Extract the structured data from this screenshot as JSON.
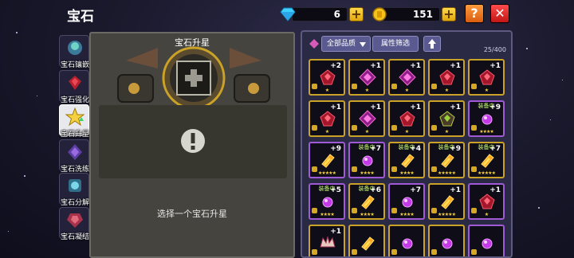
{
  "header": {
    "title": "宝石"
  },
  "currency": {
    "diamonds": "6",
    "coins": "151",
    "add_label": "+"
  },
  "buttons": {
    "help_label": "?",
    "close_label": "✕"
  },
  "tabs": [
    {
      "label": "宝石镶嵌",
      "icon": "gem-socket-icon",
      "active": false
    },
    {
      "label": "宝石强化",
      "icon": "gem-strengthen-icon",
      "active": false
    },
    {
      "label": "宝石升星",
      "icon": "star-up-icon",
      "active": true
    },
    {
      "label": "宝石洗练",
      "icon": "gem-refine-icon",
      "active": false
    },
    {
      "label": "宝石分解",
      "icon": "gem-decompose-icon",
      "active": false
    },
    {
      "label": "宝石凝结",
      "icon": "gem-condense-icon",
      "active": false
    }
  ],
  "upgrade_panel": {
    "title": "宝石升星",
    "hint": "选择一个宝石升星",
    "empty_icon": "exclamation-icon",
    "slot_icon": "plus-icon"
  },
  "inventory": {
    "filter_quality": "全部品质",
    "filter_attribute": "属性筛选",
    "sort_icon": "arrow-up-icon",
    "count": "25/400",
    "equipped_label": "装备中",
    "rows": [
      [
        {
          "lvl": "+2",
          "gem": "red-gem",
          "stars": "★",
          "equipped": false,
          "border": "gold"
        },
        {
          "lvl": "+1",
          "gem": "magenta-gem",
          "stars": "★",
          "equipped": false,
          "border": "gold"
        },
        {
          "lvl": "+1",
          "gem": "magenta-gem",
          "stars": "★",
          "equipped": false,
          "border": "gold"
        },
        {
          "lvl": "+1",
          "gem": "red-gem",
          "stars": "★",
          "equipped": false,
          "border": "gold"
        },
        {
          "lvl": "+1",
          "gem": "red-gem",
          "stars": "★",
          "equipped": false,
          "border": "gold"
        }
      ],
      [
        {
          "lvl": "+1",
          "gem": "red-gem",
          "stars": "★",
          "equipped": false,
          "border": "gold"
        },
        {
          "lvl": "+1",
          "gem": "magenta-gem",
          "stars": "★",
          "equipped": false,
          "border": "gold"
        },
        {
          "lvl": "+1",
          "gem": "red-gem",
          "stars": "★",
          "equipped": false,
          "border": "gold"
        },
        {
          "lvl": "+1",
          "gem": "green-gem",
          "stars": "★",
          "equipped": false,
          "border": "gold"
        },
        {
          "lvl": "+9",
          "gem": "purple-orb",
          "stars": "★★★★",
          "equipped": true,
          "border": "purple"
        }
      ],
      [
        {
          "lvl": "+9",
          "gem": "fire-scroll",
          "stars": "★★★★★",
          "equipped": false,
          "border": "purple"
        },
        {
          "lvl": "+7",
          "gem": "purple-orb",
          "stars": "★★★★",
          "equipped": true,
          "border": "purple"
        },
        {
          "lvl": "+4",
          "gem": "fire-scroll",
          "stars": "★★★★",
          "equipped": true,
          "border": "gold"
        },
        {
          "lvl": "+9",
          "gem": "fire-scroll",
          "stars": "★★★★★",
          "equipped": true,
          "border": "gold"
        },
        {
          "lvl": "+7",
          "gem": "fire-scroll",
          "stars": "★★★★★",
          "equipped": true,
          "border": "gold"
        }
      ],
      [
        {
          "lvl": "+5",
          "gem": "purple-orb",
          "stars": "★★★★",
          "equipped": true,
          "border": "purple"
        },
        {
          "lvl": "+6",
          "gem": "fire-scroll",
          "stars": "★★★★",
          "equipped": true,
          "border": "gold"
        },
        {
          "lvl": "+7",
          "gem": "purple-orb",
          "stars": "★★★★",
          "equipped": false,
          "border": "purple"
        },
        {
          "lvl": "+1",
          "gem": "fire-scroll",
          "stars": "★★★★★",
          "equipped": false,
          "border": "gold"
        },
        {
          "lvl": "+1",
          "gem": "red-gem",
          "stars": "★",
          "equipped": false,
          "border": "purple"
        }
      ],
      [
        {
          "lvl": "+1",
          "gem": "crown-gem",
          "stars": "",
          "equipped": false,
          "border": "gold"
        },
        {
          "lvl": "",
          "gem": "fire-scroll",
          "stars": "",
          "equipped": false,
          "border": "gold"
        },
        {
          "lvl": "",
          "gem": "purple-orb",
          "stars": "",
          "equipped": false,
          "border": "gold"
        },
        {
          "lvl": "",
          "gem": "purple-orb",
          "stars": "",
          "equipped": false,
          "border": "gold"
        },
        {
          "lvl": "",
          "gem": "purple-orb",
          "stars": "",
          "equipped": false,
          "border": "purple"
        }
      ]
    ]
  },
  "colors": {
    "gold_border": "#c9a227",
    "purple_border": "#a05ad6",
    "equipped_text": "#c8ff6e",
    "close_button": "#e02020",
    "help_button": "#f07a25"
  }
}
